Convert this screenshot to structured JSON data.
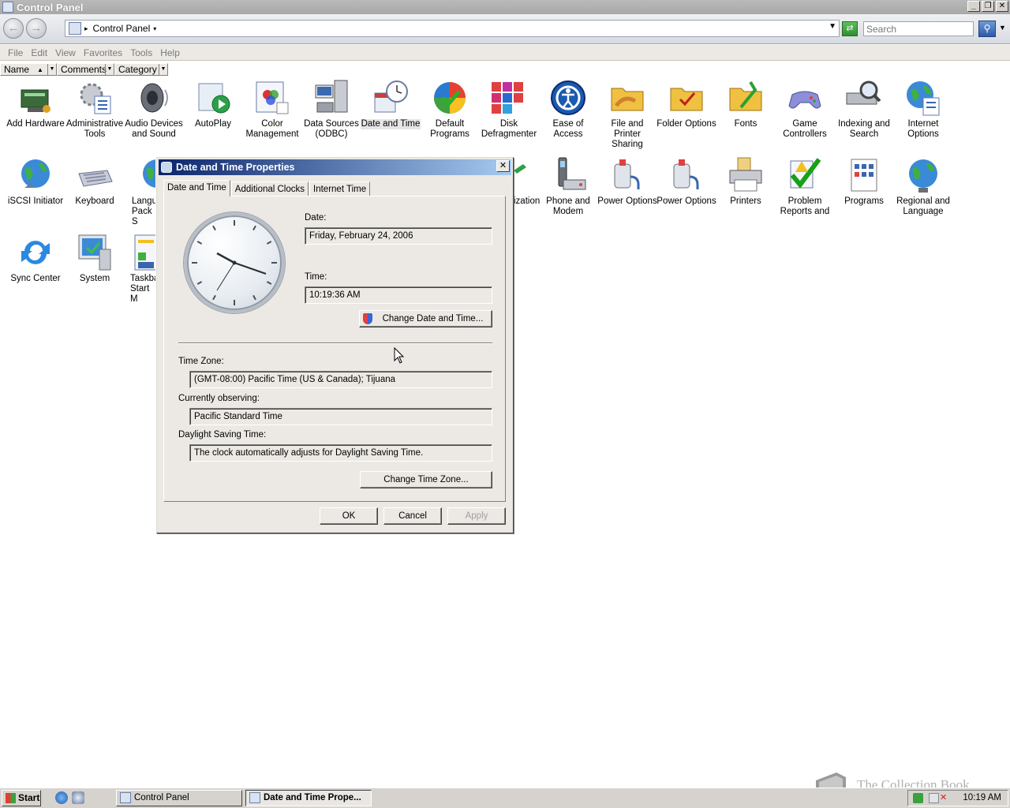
{
  "window": {
    "title": "Control Panel"
  },
  "address": {
    "path": "Control Panel",
    "search_placeholder": "Search"
  },
  "menu": [
    "File",
    "Edit",
    "View",
    "Favorites",
    "Tools",
    "Help"
  ],
  "columns": [
    "Name",
    "Comments",
    "Category"
  ],
  "icons": [
    "Add Hardware",
    "Administrative Tools",
    "Audio Devices and Sound",
    "AutoPlay",
    "Color Management",
    "Data Sources (ODBC)",
    "Date and Time",
    "Default Programs",
    "Disk Defragmenter",
    "Ease of Access",
    "File and Printer Sharing",
    "Folder Options",
    "Fonts",
    "Game Controllers",
    "Indexing and Search",
    "Internet Options",
    "iSCSI Initiator",
    "Keyboard",
    "Langu Pack S",
    "ization",
    "Phone and Modem",
    "Power Options",
    "Power Options",
    "Printers",
    "Problem Reports and",
    "Programs",
    "Regional and Language",
    "Sync Center",
    "System",
    "Taskba Start M"
  ],
  "dialog": {
    "title": "Date and Time Properties",
    "tabs": [
      "Date and Time",
      "Additional Clocks",
      "Internet Time"
    ],
    "date_label": "Date:",
    "date_value": "Friday, February 24, 2006",
    "time_label": "Time:",
    "time_value": "10:19:36 AM",
    "change_datetime": "Change Date and Time...",
    "timezone_label": "Time Zone:",
    "timezone_value": "(GMT-08:00) Pacific Time (US & Canada); Tijuana",
    "observing_label": "Currently observing:",
    "observing_value": "Pacific Standard Time",
    "dst_label": "Daylight Saving Time:",
    "dst_value": "The clock automatically adjusts for Daylight Saving Time.",
    "change_timezone": "Change Time Zone...",
    "ok": "OK",
    "cancel": "Cancel",
    "apply": "Apply"
  },
  "taskbar": {
    "start": "Start",
    "tasks": [
      "Control Panel",
      "Date and Time Prope..."
    ],
    "clock": "10:19 AM"
  },
  "watermark": "The Collection Book"
}
